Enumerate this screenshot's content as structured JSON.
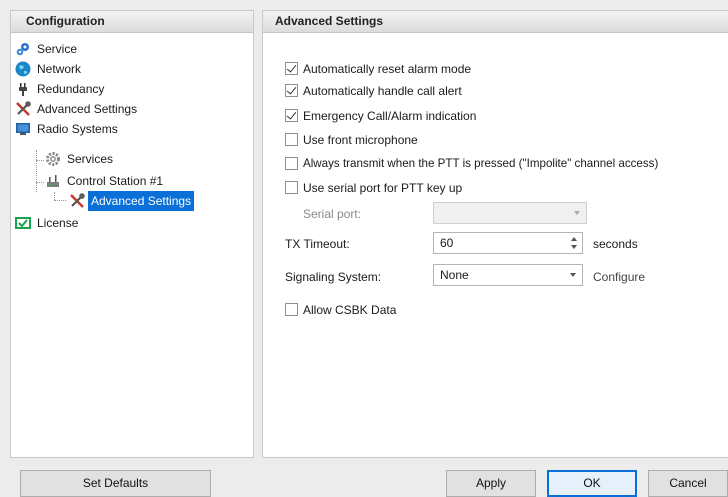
{
  "left": {
    "header": "Configuration",
    "tree": [
      {
        "label": "Service",
        "icon": "gear-cluster-icon"
      },
      {
        "label": "Network",
        "icon": "globe-icon"
      },
      {
        "label": "Redundancy",
        "icon": "plug-icon"
      },
      {
        "label": "Advanced Settings",
        "icon": "tools-icon"
      },
      {
        "label": "Radio Systems",
        "icon": "monitor-icon"
      },
      {
        "label": "Services",
        "icon": "gear-icon"
      },
      {
        "label": "Control Station #1",
        "icon": "radio-station-icon"
      },
      {
        "label": "Advanced Settings",
        "icon": "tools-icon",
        "selected": true
      },
      {
        "label": "License",
        "icon": "license-icon"
      }
    ]
  },
  "right": {
    "header": "Advanced Settings",
    "checkboxes": [
      {
        "label": "Automatically reset alarm mode",
        "checked": true
      },
      {
        "label": "Automatically handle call alert",
        "checked": true
      },
      {
        "label": "Emergency Call/Alarm indication",
        "checked": true
      },
      {
        "label": "Use front microphone",
        "checked": false
      },
      {
        "label": "Always transmit when the PTT is pressed (\"Impolite\" channel access)",
        "checked": false
      },
      {
        "label": "Use serial port for PTT key up",
        "checked": false
      }
    ],
    "serial_port": {
      "label": "Serial port:",
      "value": ""
    },
    "tx_timeout": {
      "label": "TX Timeout:",
      "value": "60",
      "unit": "seconds"
    },
    "signaling": {
      "label": "Signaling System:",
      "value": "None",
      "configure": "Configure"
    },
    "csbk": {
      "label": "Allow CSBK Data",
      "checked": false
    }
  },
  "buttons": {
    "set_defaults": "Set Defaults",
    "apply": "Apply",
    "ok": "OK",
    "cancel": "Cancel"
  },
  "colors": {
    "selection": "#0a6fd6",
    "panel_bg": "#ffffff",
    "window_bg": "#ececec"
  }
}
